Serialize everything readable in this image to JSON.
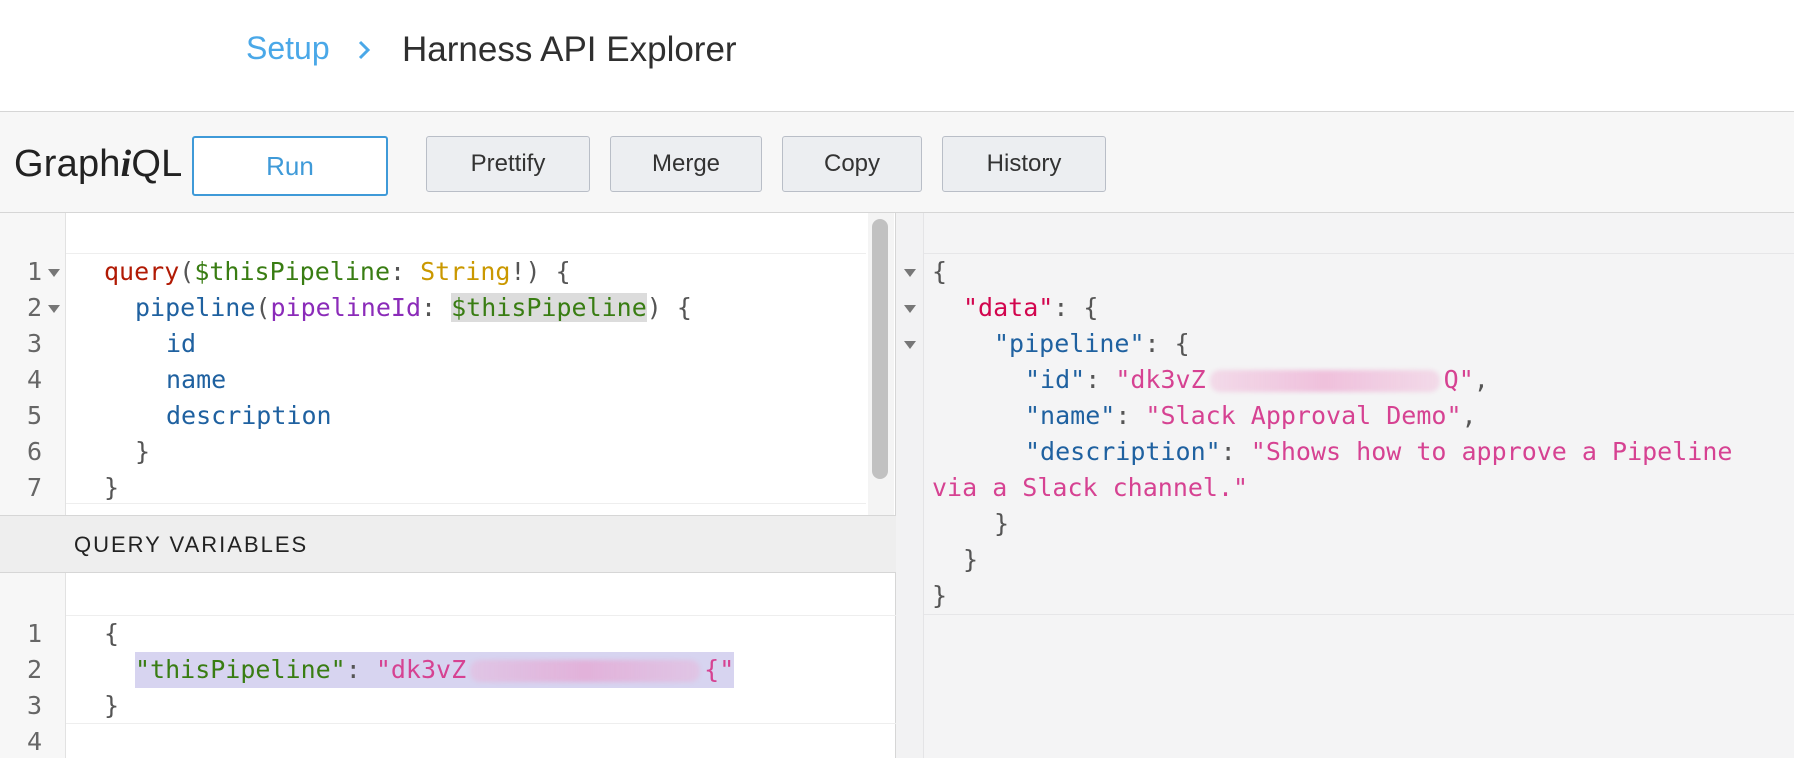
{
  "breadcrumb": {
    "setup_label": "Setup",
    "page_title": "Harness API Explorer"
  },
  "toolbar": {
    "title_prefix": "Graph",
    "title_italic": "i",
    "title_suffix": "QL",
    "run_label": "Run",
    "prettify_label": "Prettify",
    "merge_label": "Merge",
    "copy_label": "Copy",
    "history_label": "History"
  },
  "query_editor": {
    "line_numbers": [
      "1",
      "2",
      "3",
      "4",
      "5",
      "6",
      "7"
    ],
    "tokens": {
      "l1_kw": "query",
      "l1_open": "(",
      "l1_var": "$thisPipeline",
      "l1_colon": ": ",
      "l1_type": "String",
      "l1_close": "!) {",
      "l2_field": "pipeline",
      "l2_open": "(",
      "l2_arg": "pipelineId",
      "l2_colon": ": ",
      "l2_var": "$thisPipeline",
      "l2_close": ") {",
      "l3_field": "id",
      "l4_field": "name",
      "l5_field": "description",
      "l6": "}",
      "l7": "}"
    }
  },
  "variables_panel": {
    "header": "QUERY VARIABLES",
    "line_numbers": [
      "1",
      "2",
      "3",
      "4"
    ],
    "l1": "{",
    "l2_key": "\"thisPipeline\"",
    "l2_colon": ": ",
    "l2_value_start": "\"dk3vZ",
    "l2_value_end": "{\"",
    "l3": "}"
  },
  "result": {
    "l1": "{",
    "data_key": "\"data\"",
    "data_punc": ": {",
    "pipeline_key": "\"pipeline\"",
    "pipeline_punc": ": {",
    "id_key": "\"id\"",
    "id_colon": ": ",
    "id_value_start": "\"dk3vZ",
    "id_value_end": "Q\"",
    "id_comma": ",",
    "name_key": "\"name\"",
    "name_colon": ": ",
    "name_value": "\"Slack Approval Demo\"",
    "name_comma": ",",
    "desc_key": "\"description\"",
    "desc_colon": ": ",
    "desc_value_1": "\"Shows how to approve a Pipeline",
    "desc_value_2": "via a Slack channel.\"",
    "close_1": "}",
    "close_2": "}",
    "close_3": "}"
  },
  "icons": {
    "breadcrumb_separator": "chevron-right-icon",
    "fold_marker": "caret-down-icon"
  },
  "colors": {
    "link_blue": "#4aa8e8",
    "run_border": "#3f9ad8",
    "keyword": "#b11a04",
    "variable": "#397d13",
    "type": "#ca9800",
    "field": "#1f61a0",
    "argument": "#8b2bb9",
    "json_key": "#d2054e",
    "json_string": "#d64292"
  }
}
